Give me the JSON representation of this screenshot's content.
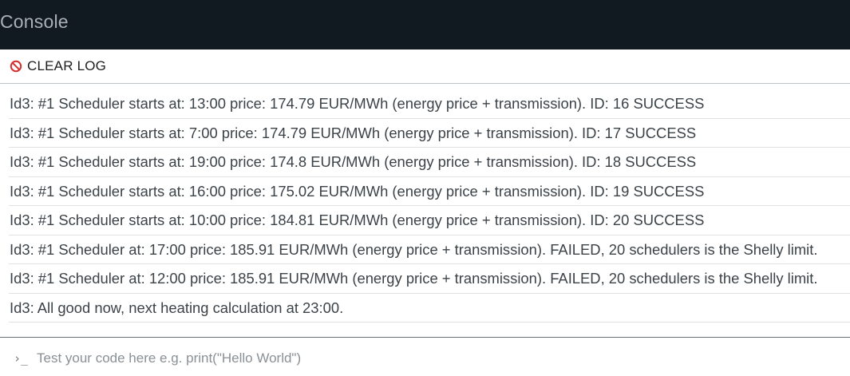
{
  "header": {
    "title": "Console",
    "background": "#121a21"
  },
  "toolbar": {
    "clear_label": "CLEAR LOG",
    "clear_icon": "no-entry-icon",
    "clear_icon_color": "#d32f2f"
  },
  "log": {
    "entries": [
      "Id3: #1 Scheduler starts at: 13:00 price: 174.79 EUR/MWh (energy price + transmission). ID: 16 SUCCESS",
      "Id3: #1 Scheduler starts at: 7:00 price: 174.79 EUR/MWh (energy price + transmission). ID: 17 SUCCESS",
      "Id3: #1 Scheduler starts at: 19:00 price: 174.8 EUR/MWh (energy price + transmission). ID: 18 SUCCESS",
      "Id3: #1 Scheduler starts at: 16:00 price: 175.02 EUR/MWh (energy price + transmission). ID: 19 SUCCESS",
      "Id3: #1 Scheduler starts at: 10:00 price: 184.81 EUR/MWh (energy price + transmission). ID: 20 SUCCESS",
      "Id3: #1 Scheduler at: 17:00 price: 185.91 EUR/MWh (energy price + transmission). FAILED, 20 schedulers is the Shelly limit.",
      "Id3: #1 Scheduler at: 12:00 price: 185.91 EUR/MWh (energy price + transmission). FAILED, 20 schedulers is the Shelly limit.",
      "Id3: All good now, next heating calculation at 23:00."
    ]
  },
  "input": {
    "prompt_symbol": "›_",
    "value": "",
    "placeholder": "Test your code here e.g. print(\"Hello World\")"
  }
}
